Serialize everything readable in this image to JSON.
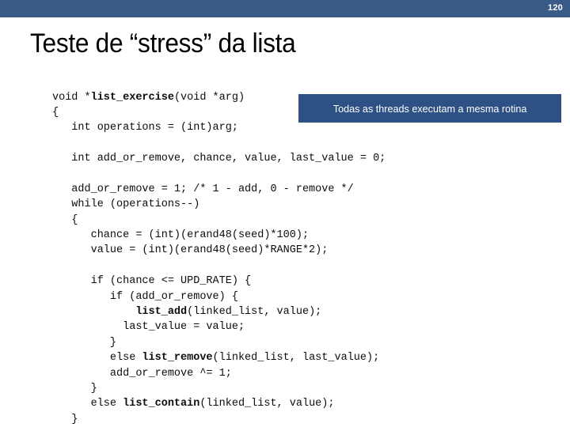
{
  "slide": {
    "page_number": "120",
    "title": "Teste de “stress” da lista",
    "header_color": "#3a5a87",
    "background_color": "#ffffff"
  },
  "callout": {
    "text": "Todas as threads executam a mesma rotina",
    "background_color": "#2d5185",
    "text_color": "#ffffff"
  },
  "code": {
    "language": "c",
    "text_color": "#0c0c0c",
    "lines": [
      "void *list_exercise(void *arg)",
      "{",
      "   int operations = (int)arg;",
      "",
      "   int add_or_remove, chance, value, last_value = 0;",
      "",
      "   add_or_remove = 1; /* 1 - add, 0 - remove */",
      "   while (operations--)",
      "   {",
      "      chance = (int)(erand48(seed)*100);",
      "      value = (int)(erand48(seed)*RANGE*2);",
      "",
      "      if (chance <= UPD_RATE) {",
      "         if (add_or_remove) {",
      "             list_add(linked_list, value);",
      "           last_value = value;",
      "         }",
      "         else list_remove(linked_list, last_value);",
      "         add_or_remove ^= 1;",
      "      }",
      "      else list_contain(linked_list, value);",
      "   }"
    ],
    "bold_tokens": [
      "list_exercise",
      "list_add",
      "list_remove",
      "list_contain"
    ]
  }
}
